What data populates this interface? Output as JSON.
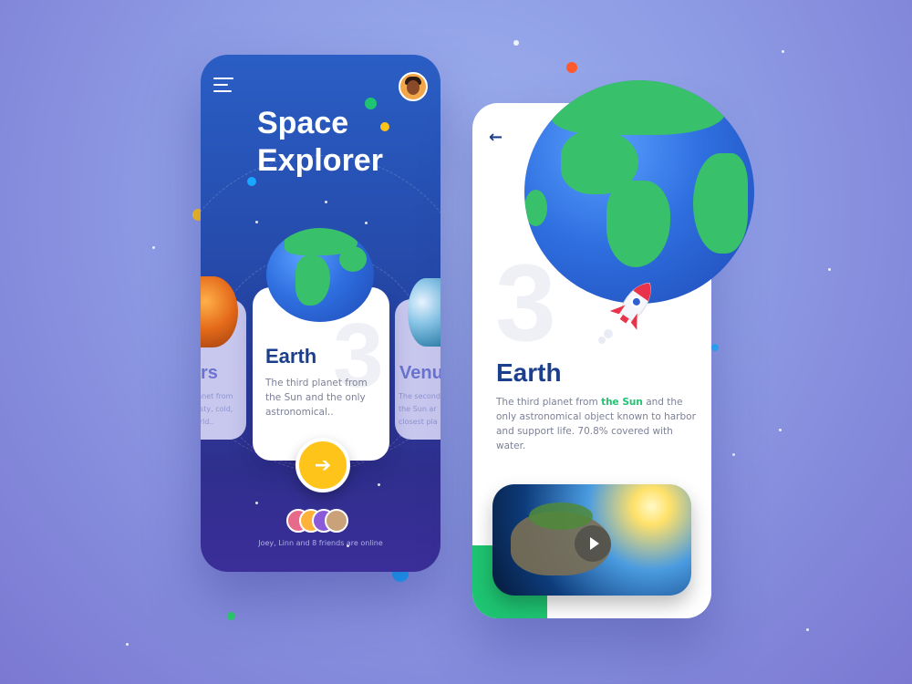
{
  "phone1": {
    "title_line1": "Space",
    "title_line2": "Explorer",
    "left_planet": {
      "name": "rs",
      "desc_line1": "lanet from",
      "desc_line2": "usty, cold,",
      "desc_line3": "orld.."
    },
    "main_planet": {
      "name": "Earth",
      "number": "3",
      "description": "The third planet from the Sun and the only astronomical.."
    },
    "right_planet": {
      "name": "Venu",
      "desc_line1": "The second",
      "desc_line2": "the Sun ar",
      "desc_line3": "closest pla"
    },
    "go_button_glyph": "➔",
    "online_text": "Joey, Linn and 8 friends are online"
  },
  "phone2": {
    "back_glyph": "←",
    "number": "3",
    "title": "Earth",
    "desc_before": "The third planet from ",
    "desc_highlight": "the Sun",
    "desc_after": " and the only astronomical object known to harbor and support life. 70.8% covered with water."
  },
  "colors": {
    "background": "#8d9be4",
    "phone1_gradient_top": "#2a5ec4",
    "phone1_gradient_bottom": "#3b2e98",
    "accent_yellow": "#ffc41a",
    "accent_green": "#1ec471",
    "title_navy": "#1b3f8d"
  },
  "icons": [
    "menu-icon",
    "avatar",
    "arrow-right-icon",
    "arrow-left-icon",
    "play-icon",
    "rocket-icon"
  ]
}
